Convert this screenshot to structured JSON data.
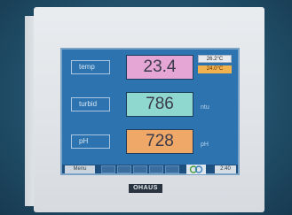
{
  "rows": [
    {
      "label": "temp",
      "value": "23.4",
      "unit": "",
      "color": "#e5a6d6"
    },
    {
      "label": "turbid",
      "value": "786",
      "unit": "ntu",
      "color": "#8ed8d0"
    },
    {
      "label": "pH",
      "value": "728",
      "unit": "pH",
      "color": "#efa868"
    }
  ],
  "badges": {
    "top": "26.2°C",
    "bottom": "24.0°C",
    "top_color": "#e6eaee",
    "bottom_color": "#f0b24f"
  },
  "bottom_bar": {
    "menu_label": "Menu",
    "time": "2:40"
  },
  "brand": "OHAUS"
}
